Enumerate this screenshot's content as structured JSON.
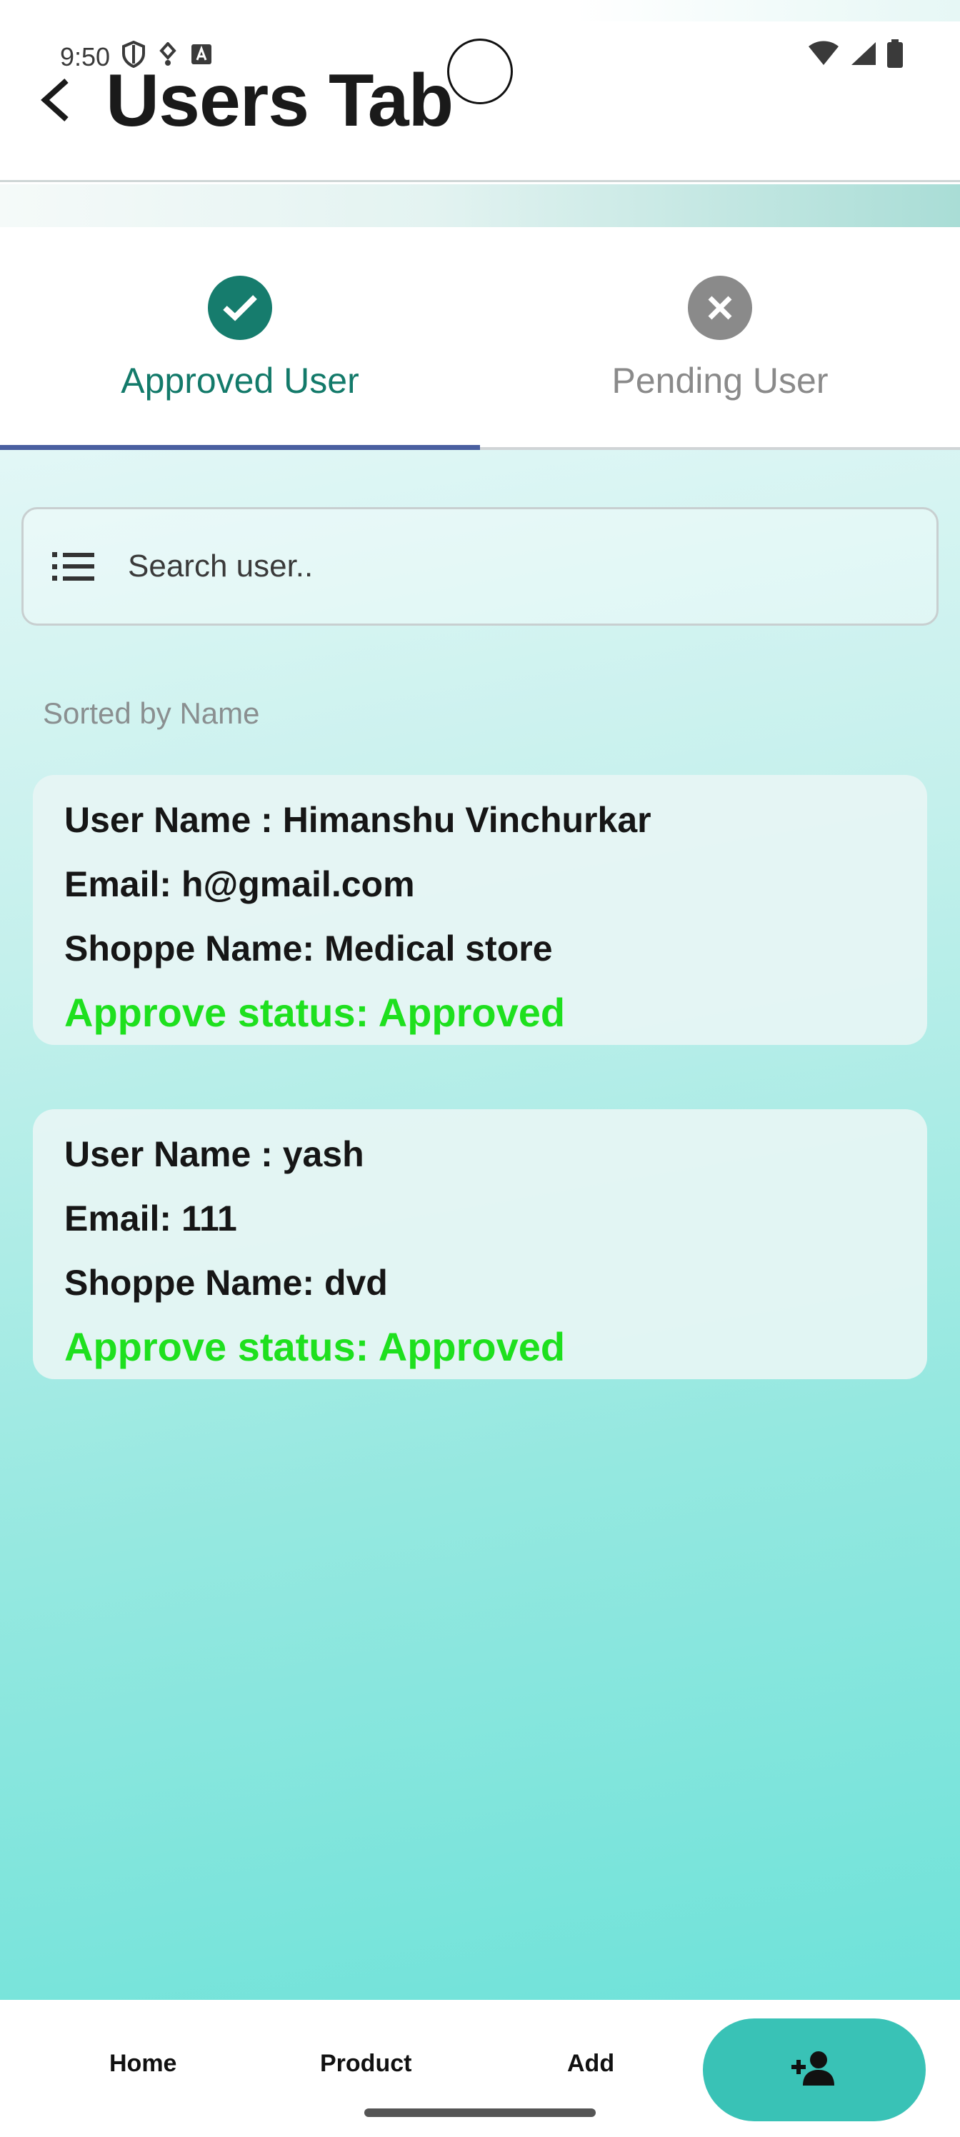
{
  "status_bar": {
    "time": "9:50"
  },
  "header": {
    "title": "Users Tab"
  },
  "tabs": [
    {
      "label": "Approved User",
      "icon": "check-circle-icon",
      "active": true
    },
    {
      "label": "Pending User",
      "icon": "cancel-circle-icon",
      "active": false
    }
  ],
  "search": {
    "placeholder": "Search user.."
  },
  "sort_label": "Sorted by Name",
  "users": [
    {
      "name": "User Name : Himanshu Vinchurkar",
      "email": "Email: h@gmail.com",
      "shop": "Shoppe Name: Medical store",
      "status": "Approve status: Approved"
    },
    {
      "name": "User Name : yash",
      "email": "Email: 111",
      "shop": "Shoppe Name: dvd",
      "status": "Approve status: Approved"
    }
  ],
  "bottom_nav": {
    "home": "Home",
    "product": "Product",
    "add": "Add",
    "add_user_icon": "person-add-icon"
  },
  "colors": {
    "accent": "#137a6a",
    "status_green": "#1ee01e",
    "nav_pill": "#39c2b6",
    "tab_indicator": "#4a5fa0"
  }
}
